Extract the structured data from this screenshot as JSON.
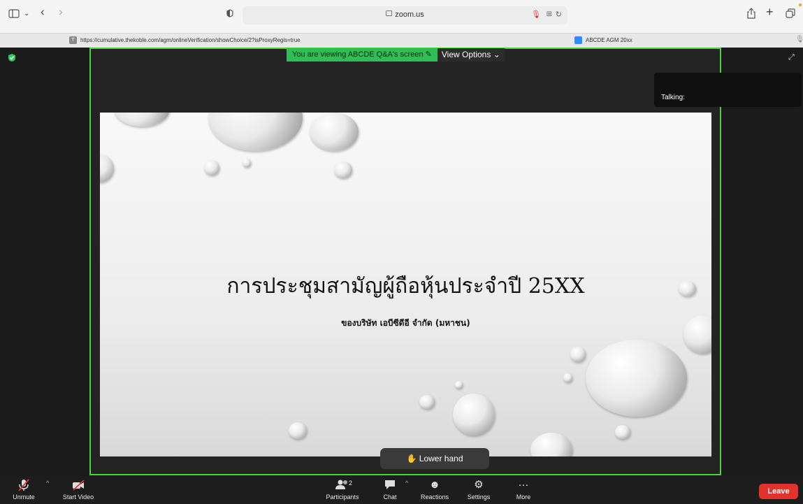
{
  "browser": {
    "address": "zoom.us",
    "tabs": [
      {
        "title": "https://cumulative.thekoble.com/agm/onlineVerification/showChoice/2?isProxyRegis=true",
        "favicon": "T"
      },
      {
        "title": "ABCDE AGM 20xx",
        "favicon": "zoom-icon"
      }
    ]
  },
  "meeting": {
    "share_banner": "You are viewing ABCDE Q&A's screen",
    "view_options": "View Options",
    "talking_label": "Talking:",
    "slide_title": "การประชุมสามัญผู้ถือหุ้นประจำปี 25XX",
    "slide_subtitle": "ของบริษัท เอบีซีดีอี จำกัด (มหาชน)",
    "lower_hand": "Lower hand"
  },
  "controls": {
    "unmute": "Unmute",
    "start_video": "Start Video",
    "participants": "Participants",
    "participants_count": "2",
    "chat": "Chat",
    "reactions": "Reactions",
    "settings": "Settings",
    "more": "More",
    "leave": "Leave"
  },
  "colors": {
    "share_border": "#4bd43a",
    "banner_green": "#2fbd56",
    "leave_red": "#e3322b"
  }
}
